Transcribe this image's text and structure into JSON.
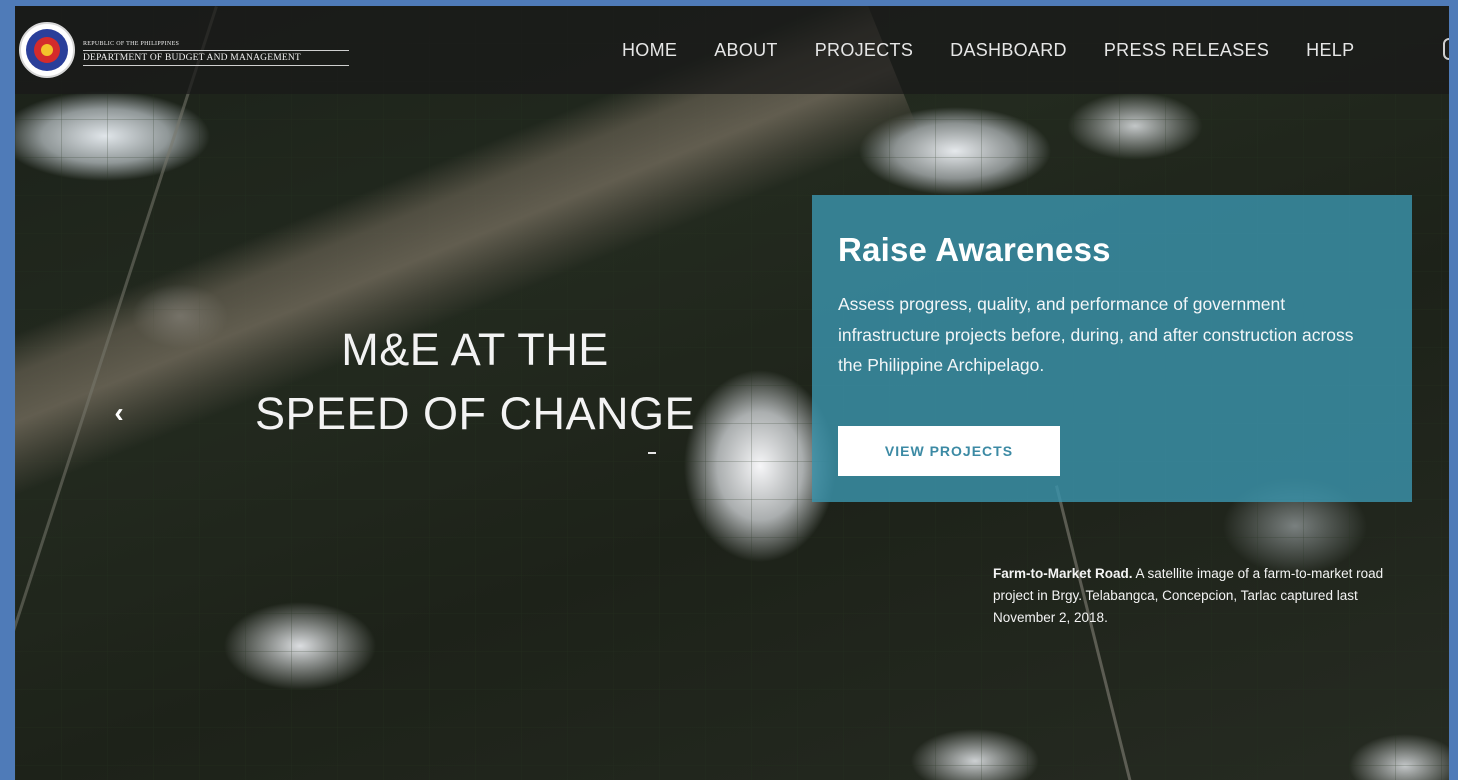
{
  "brand": {
    "line1": "REPUBLIC OF THE PHILIPPINES",
    "line2": "DEPARTMENT OF BUDGET AND MANAGEMENT"
  },
  "nav": {
    "items": [
      {
        "label": "HOME"
      },
      {
        "label": "ABOUT"
      },
      {
        "label": "PROJECTS"
      },
      {
        "label": "DASHBOARD"
      },
      {
        "label": "PRESS RELEASES"
      },
      {
        "label": "HELP"
      }
    ]
  },
  "hero": {
    "title_line1": "M&E AT THE",
    "title_line2": "SPEED OF CHANGE",
    "prev_icon": "chevron-left-icon"
  },
  "panel": {
    "title": "Raise Awareness",
    "body": "Assess progress, quality, and performance of government infrastructure projects before, during, and after construction across the Philippine Archipelago.",
    "button_label": "VIEW PROJECTS"
  },
  "caption": {
    "bold": "Farm-to-Market Road.",
    "text": " A satellite image of a farm-to-market road project in Brgy. Telabangca, Concepcion, Tarlac captured last November 2, 2018."
  },
  "colors": {
    "page_border": "#4f7bb8",
    "panel_bg": "#3a94ac",
    "button_text": "#3c8aa4",
    "navbar_bg": "#191919"
  }
}
